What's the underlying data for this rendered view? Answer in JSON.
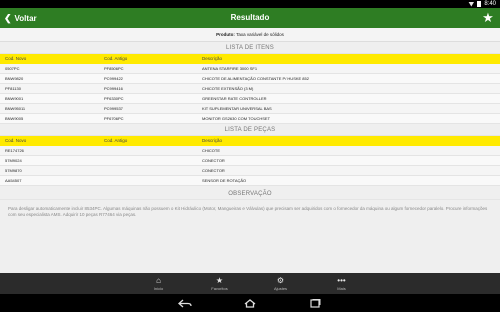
{
  "status_bar": {
    "time": "8:40"
  },
  "header": {
    "back_label": "Voltar",
    "title": "Resultado"
  },
  "product": {
    "label": "Produto:",
    "value": "Taxa variável de sólidos"
  },
  "itens": {
    "section_title": "LISTA DE ITENS",
    "columns": [
      "Cod. Novo",
      "Cod. Antigo",
      "Descrição"
    ],
    "rows": [
      [
        "0507PC",
        "PF8506PC",
        "ANTENA STARFIRE 3000 SF1"
      ],
      [
        "BNW9820",
        "PC999422",
        "CHICOTE DE ALIMENTAÇÃO CONSTANTE P/ HUSKE 852"
      ],
      [
        "PF81130",
        "PC999416",
        "CHICOTE EXTENSÃO (3 M)"
      ],
      [
        "BNW9001",
        "PF6330PC",
        "GREENSTAR RATE CONTROLLER"
      ],
      [
        "BNW95011",
        "PC999537",
        "KIT SUPLEMENTAR UNIVERSAL BAS"
      ],
      [
        "BNW9005",
        "PF6706PC",
        "MONITOR GS2630 COM TOUCHSET"
      ]
    ]
  },
  "pecas": {
    "section_title": "LISTA DE PEÇAS",
    "columns": [
      "Cod. Novo",
      "Cod. Antigo",
      "Descrição"
    ],
    "rows": [
      [
        "RE174726",
        "",
        "CHICOTE"
      ],
      [
        "57M9024",
        "",
        "CONECTOR"
      ],
      [
        "57M9870",
        "",
        "CONECTOR"
      ],
      [
        "AA54507",
        "",
        "SENSOR DE ROTAÇÃO"
      ]
    ]
  },
  "observacao": {
    "section_title": "OBSERVAÇÃO",
    "text": "Para desligar automaticamente incluir 8534PC. Algumas máquinas não possuem o Kit Hidráulico (Motor, Mangueiras e Válvulas) que precisam ser adquiridos com o fornecedor da máquina ou algum fornecedor paralelo. Procure informações com seu especialista AMS. Adquirir 10 peças R77464 via peças."
  },
  "tabs": [
    {
      "label": "Início",
      "icon": "home-icon"
    },
    {
      "label": "Favoritos",
      "icon": "star-icon"
    },
    {
      "label": "Ajustes",
      "icon": "gear-icon"
    },
    {
      "label": "Mais",
      "icon": "more-icon"
    }
  ],
  "colors": {
    "appbar": "#2e7d23",
    "table_header": "#ffea00",
    "tabbar": "#2b2b2b"
  }
}
